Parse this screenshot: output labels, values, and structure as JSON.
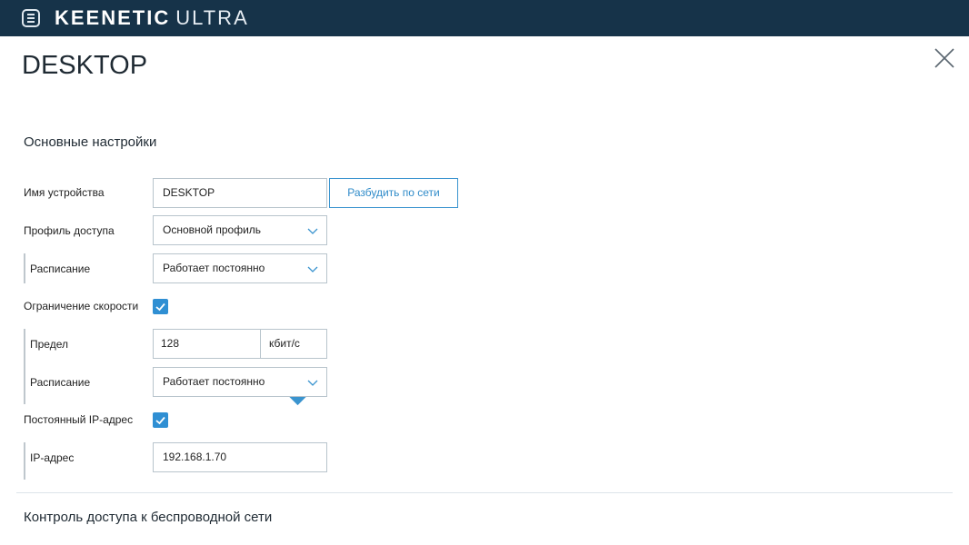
{
  "header": {
    "brand": "KEENETIC",
    "model": "ULTRA"
  },
  "page": {
    "title": "DESKTOP"
  },
  "basic_settings": {
    "title": "Основные настройки",
    "device_name": {
      "label": "Имя устройства",
      "value": "DESKTOP"
    },
    "wake_button": "Разбудить по сети",
    "access_profile": {
      "label": "Профиль доступа",
      "value": "Основной профиль"
    },
    "profile_schedule": {
      "label": "Расписание",
      "value": "Работает постоянно"
    },
    "speed_limit": {
      "label": "Ограничение скорости",
      "checked": true
    },
    "limit": {
      "label": "Предел",
      "value": "128",
      "unit": "кбит/с"
    },
    "speed_schedule": {
      "label": "Расписание",
      "value": "Работает постоянно"
    },
    "static_ip": {
      "label": "Постоянный IP-адрес",
      "checked": true
    },
    "ip_address": {
      "label": "IP-адрес",
      "value": "192.168.1.70"
    }
  },
  "wireless_access": {
    "title": "Контроль доступа к беспроводной сети"
  },
  "icons": {
    "menu": "menu-icon",
    "close": "close-icon",
    "chevron": "chevron-down-icon",
    "check": "check-icon"
  },
  "colors": {
    "header_bg": "#163349",
    "accent": "#2f8fd3",
    "border": "#b8c4cc"
  }
}
